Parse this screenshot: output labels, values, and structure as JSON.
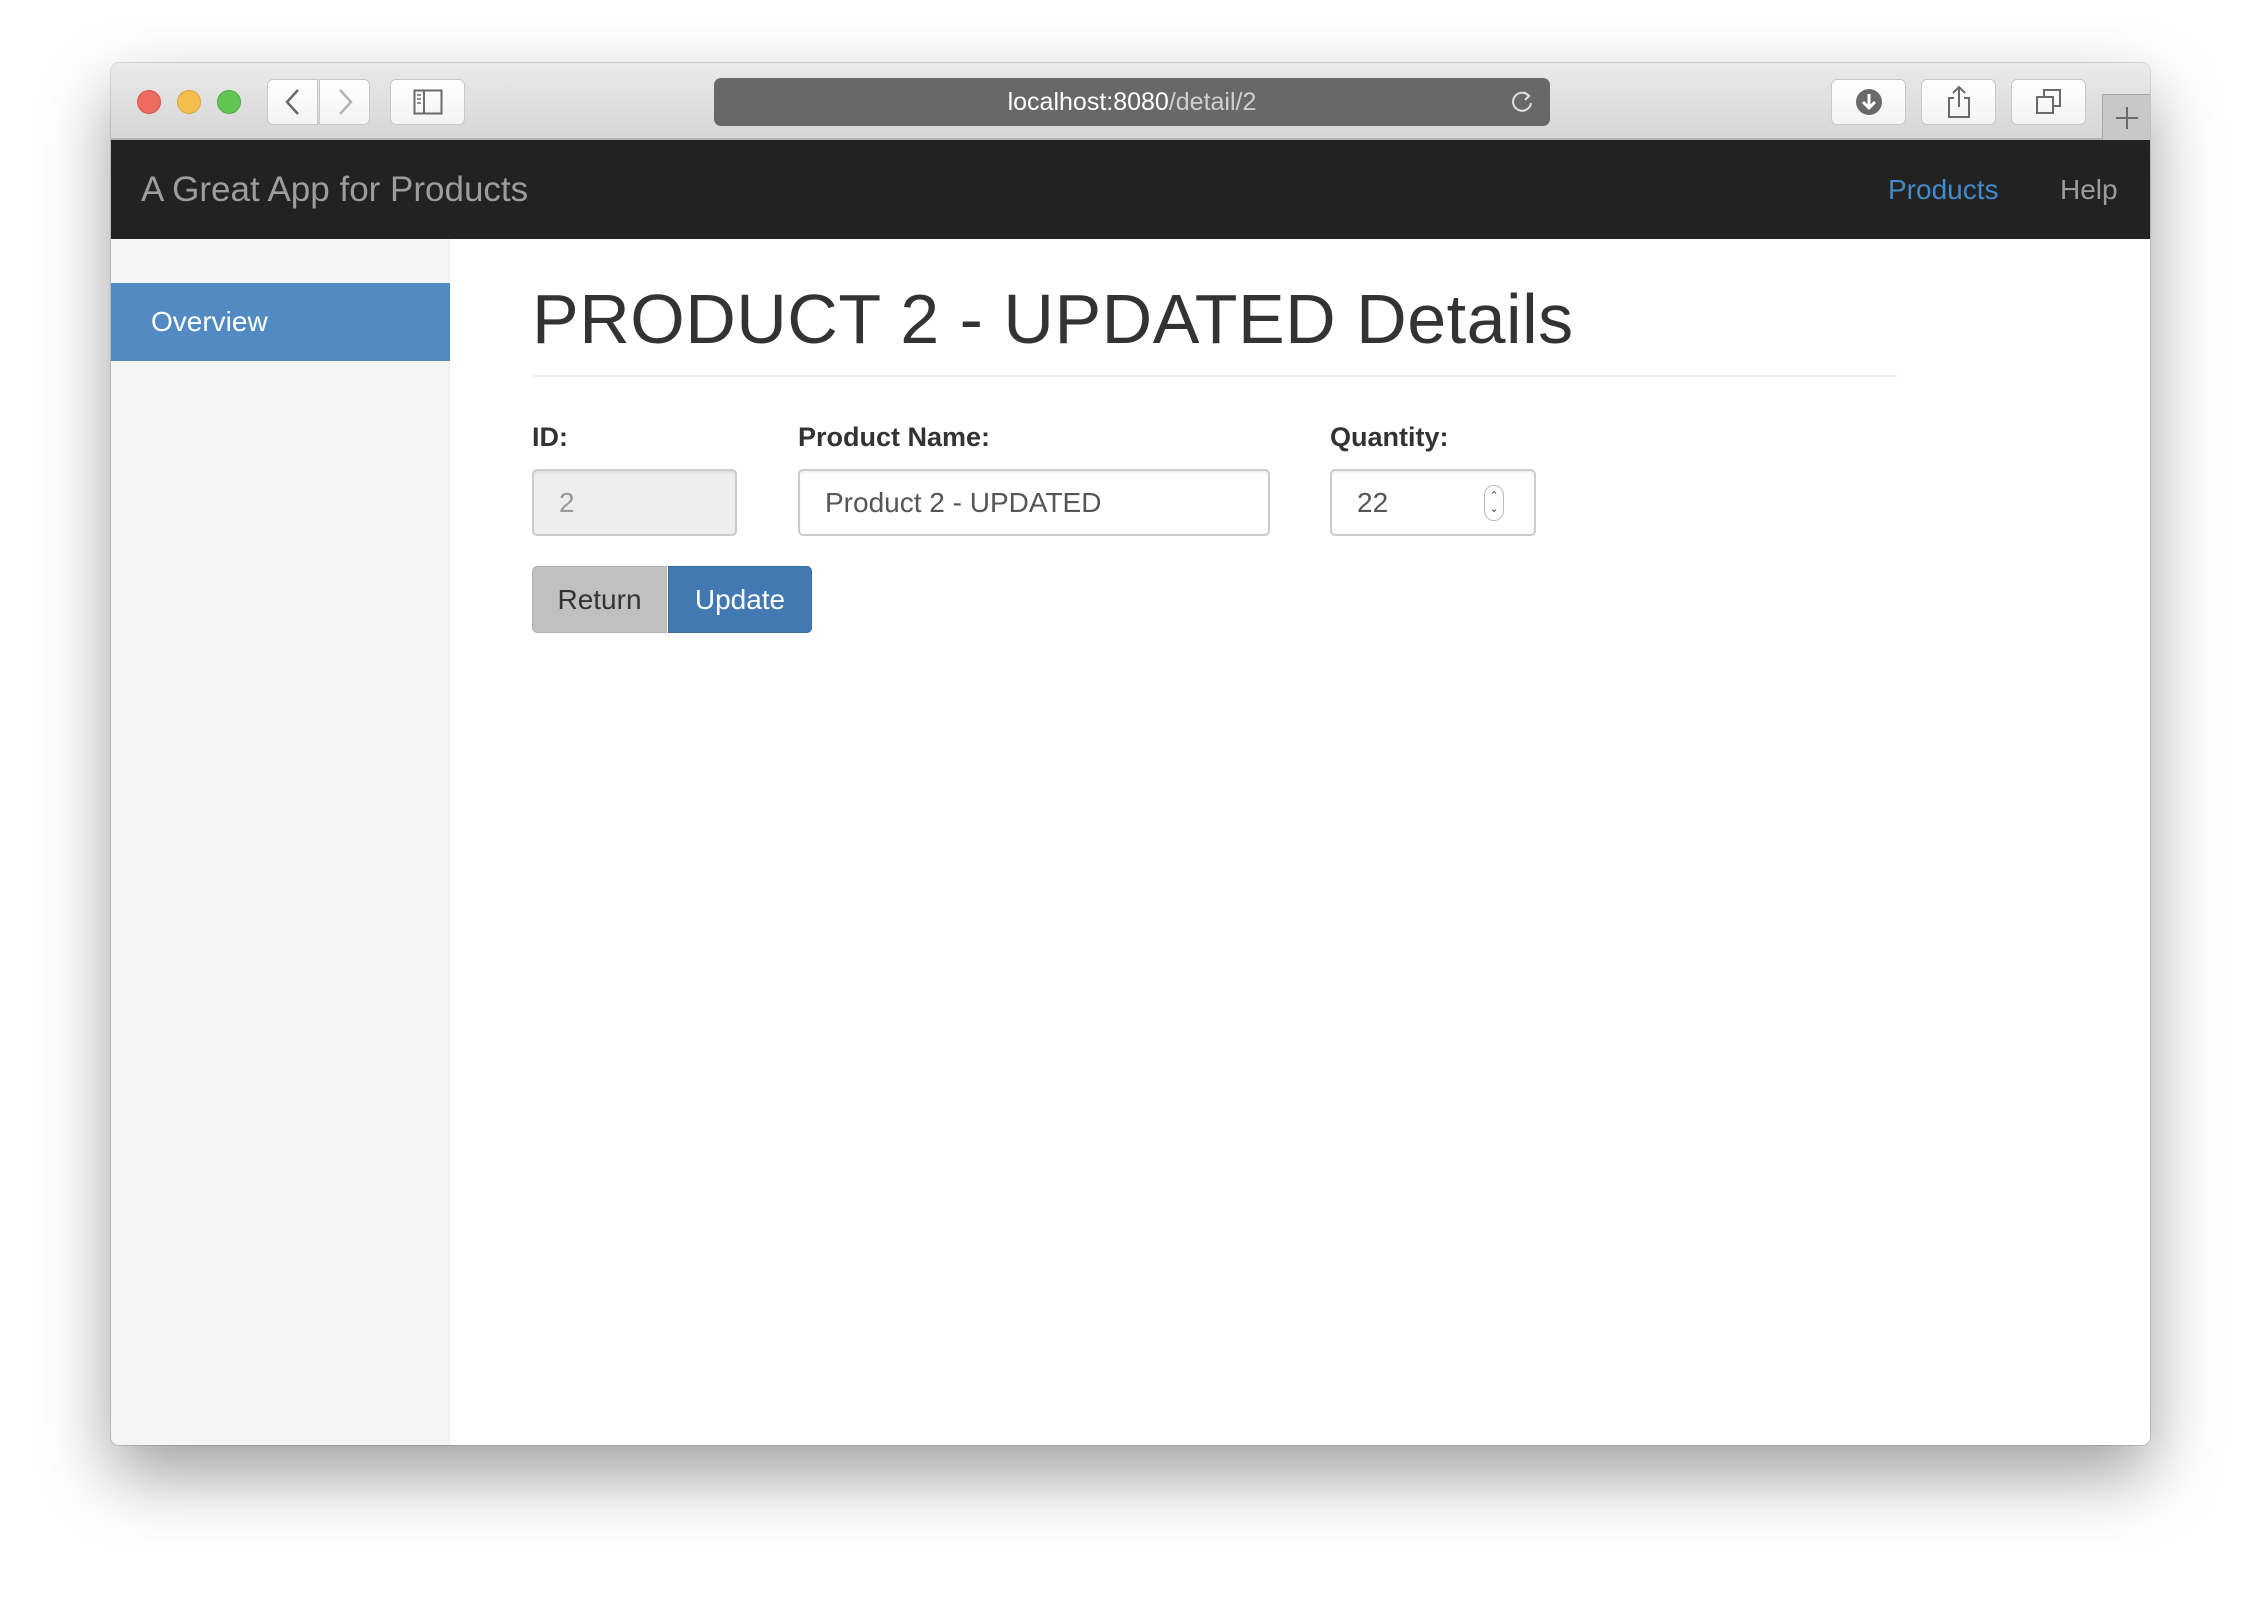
{
  "browser": {
    "url_host": "localhost:8080",
    "url_path": "/detail/2",
    "buttons": {
      "back": "chevron-left-icon",
      "forward": "chevron-right-icon",
      "sidebar": "sidebar-icon",
      "download": "download-icon",
      "share": "share-icon",
      "tabs": "tabs-icon",
      "new_tab": "plus-icon",
      "reload": "reload-icon"
    }
  },
  "navbar": {
    "brand": "A Great App for Products",
    "links": [
      {
        "label": "Products",
        "active": true
      },
      {
        "label": "Help",
        "active": false
      }
    ]
  },
  "sidebar": {
    "items": [
      {
        "label": "Overview",
        "active": true
      }
    ]
  },
  "main": {
    "title": "PRODUCT 2 - UPDATED Details",
    "fields": {
      "id": {
        "label": "ID:",
        "value": "2",
        "disabled": true
      },
      "name": {
        "label": "Product Name:",
        "value": "Product 2 - UPDATED"
      },
      "quantity": {
        "label": "Quantity:",
        "value": "22"
      }
    },
    "buttons": {
      "return": "Return",
      "update": "Update"
    }
  },
  "colors": {
    "navbar_bg": "#222222",
    "active_link": "#428bca",
    "sidebar_active": "#528bc4",
    "update_button": "#4379b3",
    "return_button": "#c0c0c0"
  }
}
